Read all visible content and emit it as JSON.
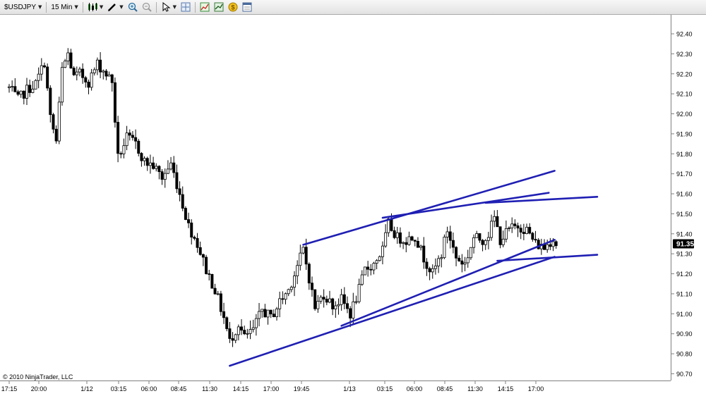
{
  "toolbar": {
    "instrument": "$USDJPY",
    "interval": "15 Min"
  },
  "copyright": "© 2010 NinjaTrader, LLC",
  "colors": {
    "trendline": "#1f1fb4",
    "candle": "#000000",
    "price_box": "#000000",
    "price_text": "#ffffff"
  },
  "chart_data": {
    "type": "candlestick",
    "instrument": "$USDJPY",
    "interval": "15 Min",
    "ylim": [
      90.7,
      92.45
    ],
    "y_ticks": [
      "92.40",
      "92.30",
      "92.20",
      "92.10",
      "92.00",
      "91.90",
      "91.80",
      "91.70",
      "91.60",
      "91.50",
      "91.40",
      "91.30",
      "91.20",
      "91.10",
      "91.00",
      "90.90",
      "90.80",
      "90.70"
    ],
    "x_ticks": [
      "17:15",
      "20:00",
      "1/12",
      "03:15",
      "06:00",
      "08:45",
      "11:30",
      "14:15",
      "17:00",
      "19:45",
      "1/13",
      "03:15",
      "06:00",
      "08:45",
      "11:30",
      "14:15",
      "17:00"
    ],
    "last_price": "91.35",
    "close_path": [
      [
        0,
        92.13
      ],
      [
        3,
        92.07
      ],
      [
        6,
        92.12
      ],
      [
        9,
        92.15
      ],
      [
        12,
        92.26
      ],
      [
        14,
        91.98
      ],
      [
        16,
        91.86
      ],
      [
        18,
        92.22
      ],
      [
        20,
        92.3
      ],
      [
        22,
        92.18
      ],
      [
        24,
        92.2
      ],
      [
        27,
        92.16
      ],
      [
        30,
        92.25
      ],
      [
        33,
        92.2
      ],
      [
        35,
        92.16
      ],
      [
        37,
        91.78
      ],
      [
        40,
        91.88
      ],
      [
        43,
        91.85
      ],
      [
        46,
        91.76
      ],
      [
        49,
        91.74
      ],
      [
        52,
        91.68
      ],
      [
        55,
        91.75
      ],
      [
        58,
        91.6
      ],
      [
        61,
        91.44
      ],
      [
        64,
        91.35
      ],
      [
        67,
        91.22
      ],
      [
        70,
        91.12
      ],
      [
        73,
        90.98
      ],
      [
        75,
        90.86
      ],
      [
        78,
        90.95
      ],
      [
        80,
        90.88
      ],
      [
        83,
        90.92
      ],
      [
        86,
        91.02
      ],
      [
        89,
        90.98
      ],
      [
        92,
        91.06
      ],
      [
        95,
        91.12
      ],
      [
        97,
        91.2
      ],
      [
        100,
        91.32
      ],
      [
        102,
        91.18
      ],
      [
        104,
        91.03
      ],
      [
        107,
        91.1
      ],
      [
        110,
        91.04
      ],
      [
        113,
        91.07
      ],
      [
        116,
        91.0
      ],
      [
        119,
        91.12
      ],
      [
        121,
        91.22
      ],
      [
        124,
        91.25
      ],
      [
        127,
        91.32
      ],
      [
        129,
        91.45
      ],
      [
        132,
        91.38
      ],
      [
        135,
        91.37
      ],
      [
        138,
        91.39
      ],
      [
        141,
        91.28
      ],
      [
        144,
        91.2
      ],
      [
        147,
        91.3
      ],
      [
        149,
        91.42
      ],
      [
        152,
        91.28
      ],
      [
        155,
        91.25
      ],
      [
        158,
        91.38
      ],
      [
        161,
        91.37
      ],
      [
        163,
        91.4
      ],
      [
        165,
        91.48
      ],
      [
        167,
        91.37
      ],
      [
        170,
        91.42
      ],
      [
        173,
        91.44
      ],
      [
        176,
        91.42
      ],
      [
        179,
        91.35
      ],
      [
        182,
        91.33
      ],
      [
        185,
        91.38
      ],
      [
        186,
        91.35
      ]
    ],
    "trendlines": [
      {
        "from": [
          100,
          91.345
        ],
        "to": [
          185.5,
          91.715
        ]
      },
      {
        "from": [
          127,
          91.48
        ],
        "to": [
          183.5,
          91.605
        ]
      },
      {
        "from": [
          162,
          91.555
        ],
        "to": [
          200,
          91.585
        ]
      },
      {
        "from": [
          75,
          90.74
        ],
        "to": [
          185.5,
          91.285
        ]
      },
      {
        "from": [
          113,
          90.94
        ],
        "to": [
          185.5,
          91.37
        ]
      },
      {
        "from": [
          166,
          91.265
        ],
        "to": [
          200,
          91.295
        ]
      }
    ]
  }
}
